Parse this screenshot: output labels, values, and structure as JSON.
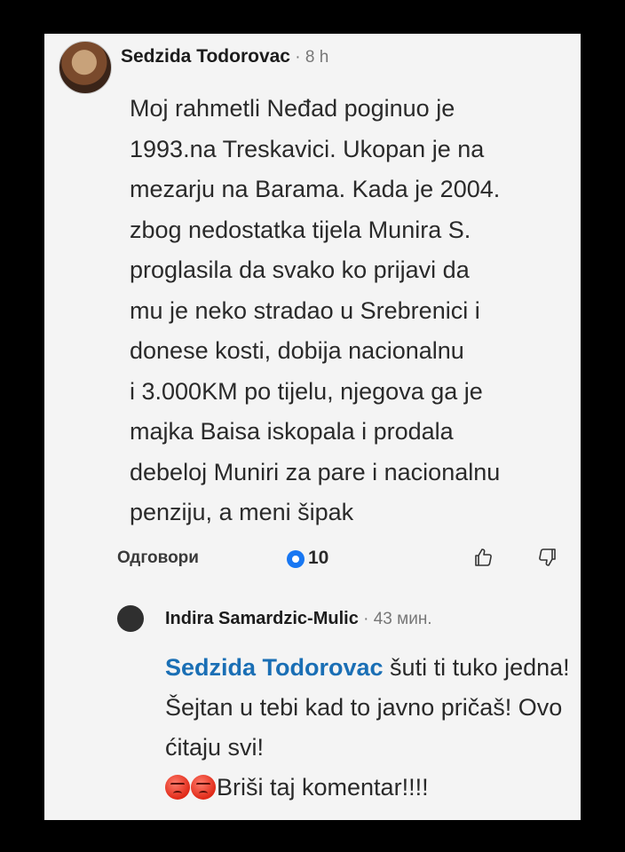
{
  "comment1": {
    "author": "Sedzida Todorovac",
    "time": " · 8 h",
    "text": "Moj rahmetli Neđad poginuo je\n1993.na Treskavici. Ukopan je na\nmezarju na Barama. Kada je 2004.\nzbog nedostatka tijela  Munira S.\nproglasila da svako ko prijavi da\nmu je neko stradao  u Srebrenici i\ndonese kosti, dobija nacionalnu\ni 3.000KM po tijelu, njegova ga je\nmajka Baisa iskopala i  prodala\ndebeloj Muniri za pare i nacionalnu\npenziju, a meni šipak",
    "reply_label": "Одговори",
    "reaction_count": "10",
    "reaction_color": "#1877f2"
  },
  "comment2": {
    "author": "Indira Samardzic-Mulic",
    "time": " · 43 мин.",
    "mention": "Sedzida Todorovac",
    "text_part1": " šuti ti tuko jedna! Šejtan u tebi kad to javno pričaš! Ovo ćitaju svi!",
    "text_part2": "Briši taj komentar!!!!",
    "mention_color": "#1a6fb5"
  },
  "icons": [
    "avatar",
    "reaction-icon",
    "like-icon",
    "dislike-icon",
    "angry-emoji-icon"
  ]
}
